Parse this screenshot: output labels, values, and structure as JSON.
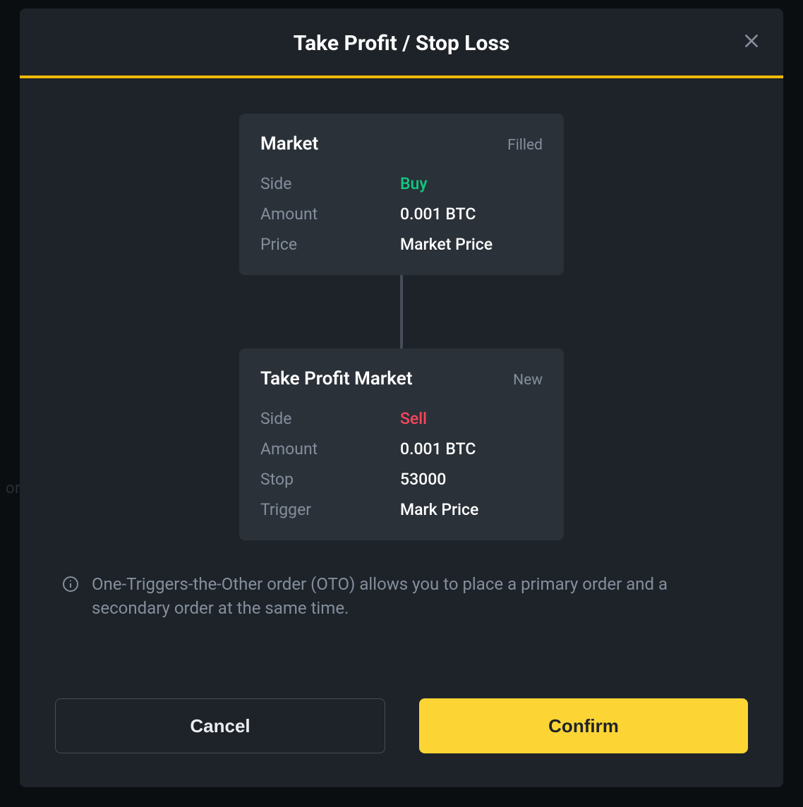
{
  "bg_hint": "ory",
  "modal": {
    "title": "Take Profit / Stop Loss",
    "info_text": "One-Triggers-the-Other order (OTO) allows you to place a primary order and a secondary order at the same time.",
    "cancel_label": "Cancel",
    "confirm_label": "Confirm"
  },
  "primary": {
    "title": "Market",
    "status": "Filled",
    "side_label": "Side",
    "side_value": "Buy",
    "amount_label": "Amount",
    "amount_value": "0.001 BTC",
    "price_label": "Price",
    "price_value": "Market Price"
  },
  "secondary": {
    "title": "Take Profit Market",
    "status": "New",
    "side_label": "Side",
    "side_value": "Sell",
    "amount_label": "Amount",
    "amount_value": "0.001 BTC",
    "stop_label": "Stop",
    "stop_value": "53000",
    "trigger_label": "Trigger",
    "trigger_value": "Mark Price"
  }
}
